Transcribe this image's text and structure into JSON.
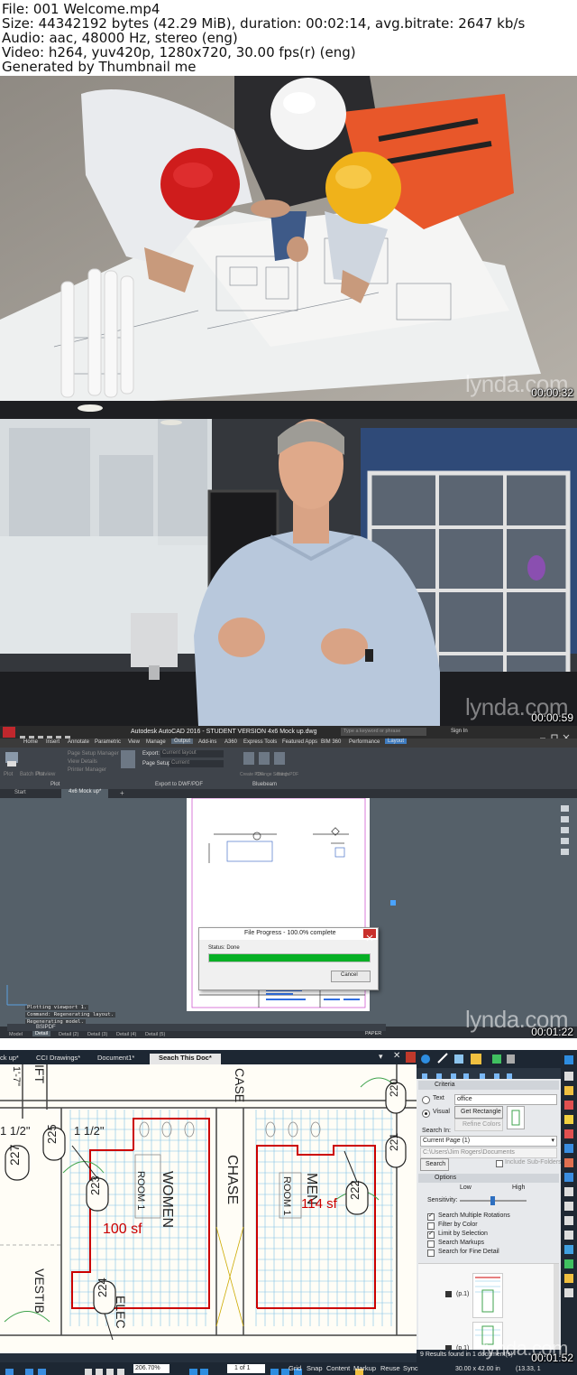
{
  "header": {
    "line1": "File: 001 Welcome.mp4",
    "line2": "Size: 44342192 bytes (42.29 MiB), duration: 00:02:14, avg.bitrate: 2647 kb/s",
    "line3": "Audio: aac, 48000 Hz, stereo (eng)",
    "line4": "Video: h264, yuv420p, 1280x720, 30.00 fps(r) (eng)",
    "line5": "Generated by Thumbnail me"
  },
  "watermark": "lynda.com",
  "frames": [
    {
      "timestamp": "00:00:32"
    },
    {
      "timestamp": "00:00:59"
    },
    {
      "timestamp": "00:01:22"
    },
    {
      "timestamp": "00:01:52"
    }
  ],
  "autocad": {
    "title": "Autodesk AutoCAD 2016 - STUDENT VERSION    4x6 Mock up.dwg",
    "search_placeholder": "Type a keyword or phrase",
    "sign_in": "Sign In",
    "ribbon_tabs": [
      "Home",
      "Insert",
      "Annotate",
      "Parametric",
      "View",
      "Manage",
      "Output",
      "Add-ins",
      "A360",
      "Express Tools",
      "Featured Apps",
      "BIM 360",
      "Performance",
      "Layout"
    ],
    "panels": {
      "plot_items": [
        "Page Setup Manager",
        "View Details",
        "Printer Manager"
      ],
      "plot_label": "Plot",
      "plot_buttons": [
        "Plot",
        "Batch Plot",
        "Preview"
      ],
      "export_label": "Export:",
      "export_value": "Current layout",
      "page_setup_label": "Page Setup:",
      "page_setup_value": "Current",
      "export_panel": "Export to DWF/PDF",
      "bluebeam_panel": "Bluebeam",
      "bb_buttons": [
        "Create PDF",
        "Change Settings",
        "Batch PDF"
      ]
    },
    "doc_tabs": [
      "Start",
      "4x6 Mock up*"
    ],
    "dialog": {
      "title": "File Progress - 100.0% complete",
      "status": "Status: Done",
      "progress": 1.0,
      "cancel": "Cancel"
    },
    "command_lines": [
      "Plotting viewport 1.",
      "Command: Regenerating layout.",
      "Regenerating model."
    ],
    "command_input": "BSIPDF",
    "layout_tabs": [
      "Model",
      "Detail",
      "Detail (2)",
      "Detail (3)",
      "Detail (4)",
      "Detail (5)"
    ],
    "paper": "PAPER"
  },
  "bluebeam": {
    "tabs": [
      "ck up*",
      "CCI Drawings*",
      "Document1*",
      "Seach This Doc*"
    ],
    "drawing": {
      "rooms": [
        "220",
        "221",
        "222",
        "223",
        "224",
        "225",
        "227"
      ],
      "labels": [
        "WOMEN",
        "MEN",
        "CHASE",
        "CASE",
        "ROOM 1",
        "ROOM 1",
        "VESTIB",
        "ELEC",
        "IFT",
        "1'-7\"",
        "1 1/2\"",
        "1 1/2\""
      ],
      "areas": [
        "100 sf",
        "114 sf"
      ]
    },
    "search_panel": {
      "criteria": "Criteria",
      "text_label": "Text",
      "text_value": "office",
      "visual_label": "Visual",
      "get_rectangle": "Get Rectangle",
      "refine_colors": "Refine Colors",
      "search_in": "Search In:",
      "search_in_value": "Current Page (1)",
      "path": "C:\\Users\\Jim Rogers\\Documents",
      "include_sub": "Include Sub-Folders",
      "search_button": "Search",
      "options": "Options",
      "sensitivity": "Sensitivity:",
      "low": "Low",
      "high": "High",
      "option_items": [
        {
          "label": "Search Multiple Rotations",
          "checked": true
        },
        {
          "label": "Filter by Color",
          "checked": false
        },
        {
          "label": "Limit by Selection",
          "checked": true
        },
        {
          "label": "Search Markups",
          "checked": false
        },
        {
          "label": "Search for Fine Detail",
          "checked": false
        }
      ],
      "result_labels": [
        "(p.1)",
        "(p.1)"
      ],
      "results_count": "9 Results found in 1 document(s)"
    },
    "zoom": "206.70%",
    "page": "1 of 1",
    "dimensions": "30.00 x 42.00 in",
    "coords": "(13.33, 1",
    "status_items": [
      "Grid",
      "Snap",
      "Content",
      "Markup",
      "Reuse",
      "Sync"
    ]
  },
  "colors": {
    "autocad_red": "#c1272d",
    "progress_green": "#06b025",
    "bluebeam_dark": "#1d2733",
    "markup_red": "#cc0000"
  }
}
